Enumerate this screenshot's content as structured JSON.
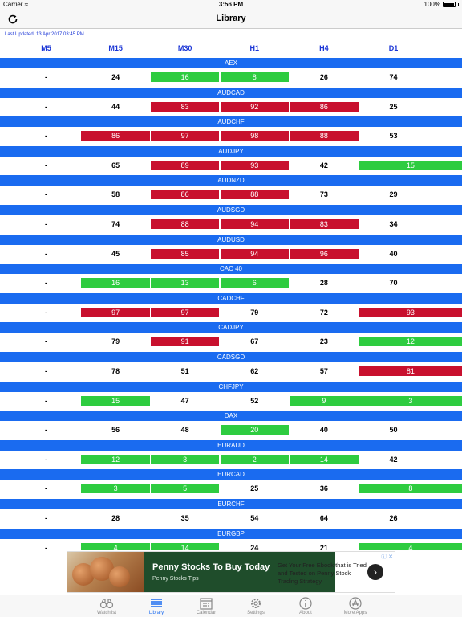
{
  "status": {
    "carrier": "Carrier",
    "time": "3:56 PM",
    "battery": "100%"
  },
  "nav": {
    "title": "Library"
  },
  "last_updated": "Last Updated: 13 Apr 2017 03:45 PM",
  "columns": [
    "M5",
    "M15",
    "M30",
    "H1",
    "H4",
    "D1"
  ],
  "colors": {
    "band": "#1a6bf0",
    "green": "#2ecc40",
    "red": "#c8102e",
    "header": "#1a35d6"
  },
  "rows": [
    {
      "symbol": "AEX",
      "cells": [
        {
          "v": "-",
          "c": ""
        },
        {
          "v": "24",
          "c": ""
        },
        {
          "v": "16",
          "c": "green"
        },
        {
          "v": "8",
          "c": "green"
        },
        {
          "v": "26",
          "c": ""
        },
        {
          "v": "74",
          "c": ""
        }
      ]
    },
    {
      "symbol": "AUDCAD",
      "cells": [
        {
          "v": "-",
          "c": ""
        },
        {
          "v": "44",
          "c": ""
        },
        {
          "v": "83",
          "c": "red"
        },
        {
          "v": "92",
          "c": "red"
        },
        {
          "v": "86",
          "c": "red"
        },
        {
          "v": "25",
          "c": ""
        }
      ]
    },
    {
      "symbol": "AUDCHF",
      "cells": [
        {
          "v": "-",
          "c": ""
        },
        {
          "v": "86",
          "c": "red"
        },
        {
          "v": "97",
          "c": "red"
        },
        {
          "v": "98",
          "c": "red"
        },
        {
          "v": "88",
          "c": "red"
        },
        {
          "v": "53",
          "c": ""
        }
      ]
    },
    {
      "symbol": "AUDJPY",
      "cells": [
        {
          "v": "-",
          "c": ""
        },
        {
          "v": "65",
          "c": ""
        },
        {
          "v": "89",
          "c": "red"
        },
        {
          "v": "93",
          "c": "red"
        },
        {
          "v": "42",
          "c": ""
        },
        {
          "v": "15",
          "c": "green"
        }
      ]
    },
    {
      "symbol": "AUDNZD",
      "cells": [
        {
          "v": "-",
          "c": ""
        },
        {
          "v": "58",
          "c": ""
        },
        {
          "v": "86",
          "c": "red"
        },
        {
          "v": "88",
          "c": "red"
        },
        {
          "v": "73",
          "c": ""
        },
        {
          "v": "29",
          "c": ""
        }
      ]
    },
    {
      "symbol": "AUDSGD",
      "cells": [
        {
          "v": "-",
          "c": ""
        },
        {
          "v": "74",
          "c": ""
        },
        {
          "v": "88",
          "c": "red"
        },
        {
          "v": "94",
          "c": "red"
        },
        {
          "v": "83",
          "c": "red"
        },
        {
          "v": "34",
          "c": ""
        }
      ]
    },
    {
      "symbol": "AUDUSD",
      "cells": [
        {
          "v": "-",
          "c": ""
        },
        {
          "v": "45",
          "c": ""
        },
        {
          "v": "85",
          "c": "red"
        },
        {
          "v": "94",
          "c": "red"
        },
        {
          "v": "96",
          "c": "red"
        },
        {
          "v": "40",
          "c": ""
        }
      ]
    },
    {
      "symbol": "CAC 40",
      "cells": [
        {
          "v": "-",
          "c": ""
        },
        {
          "v": "16",
          "c": "green"
        },
        {
          "v": "13",
          "c": "green"
        },
        {
          "v": "6",
          "c": "green"
        },
        {
          "v": "28",
          "c": ""
        },
        {
          "v": "70",
          "c": ""
        }
      ]
    },
    {
      "symbol": "CADCHF",
      "cells": [
        {
          "v": "-",
          "c": ""
        },
        {
          "v": "97",
          "c": "red"
        },
        {
          "v": "97",
          "c": "red"
        },
        {
          "v": "79",
          "c": ""
        },
        {
          "v": "72",
          "c": ""
        },
        {
          "v": "93",
          "c": "red"
        }
      ]
    },
    {
      "symbol": "CADJPY",
      "cells": [
        {
          "v": "-",
          "c": ""
        },
        {
          "v": "79",
          "c": ""
        },
        {
          "v": "91",
          "c": "red"
        },
        {
          "v": "67",
          "c": ""
        },
        {
          "v": "23",
          "c": ""
        },
        {
          "v": "12",
          "c": "green"
        }
      ]
    },
    {
      "symbol": "CADSGD",
      "cells": [
        {
          "v": "-",
          "c": ""
        },
        {
          "v": "78",
          "c": ""
        },
        {
          "v": "51",
          "c": ""
        },
        {
          "v": "62",
          "c": ""
        },
        {
          "v": "57",
          "c": ""
        },
        {
          "v": "81",
          "c": "red"
        }
      ]
    },
    {
      "symbol": "CHFJPY",
      "cells": [
        {
          "v": "-",
          "c": ""
        },
        {
          "v": "15",
          "c": "green"
        },
        {
          "v": "47",
          "c": ""
        },
        {
          "v": "52",
          "c": ""
        },
        {
          "v": "9",
          "c": "green"
        },
        {
          "v": "3",
          "c": "green"
        }
      ]
    },
    {
      "symbol": "DAX",
      "cells": [
        {
          "v": "-",
          "c": ""
        },
        {
          "v": "56",
          "c": ""
        },
        {
          "v": "48",
          "c": ""
        },
        {
          "v": "20",
          "c": "green"
        },
        {
          "v": "40",
          "c": ""
        },
        {
          "v": "50",
          "c": ""
        }
      ]
    },
    {
      "symbol": "EURAUD",
      "cells": [
        {
          "v": "-",
          "c": ""
        },
        {
          "v": "12",
          "c": "green"
        },
        {
          "v": "3",
          "c": "green"
        },
        {
          "v": "2",
          "c": "green"
        },
        {
          "v": "14",
          "c": "green"
        },
        {
          "v": "42",
          "c": ""
        }
      ]
    },
    {
      "symbol": "EURCAD",
      "cells": [
        {
          "v": "-",
          "c": ""
        },
        {
          "v": "3",
          "c": "green"
        },
        {
          "v": "5",
          "c": "green"
        },
        {
          "v": "25",
          "c": ""
        },
        {
          "v": "36",
          "c": ""
        },
        {
          "v": "8",
          "c": "green"
        }
      ]
    },
    {
      "symbol": "EURCHF",
      "cells": [
        {
          "v": "-",
          "c": ""
        },
        {
          "v": "28",
          "c": ""
        },
        {
          "v": "35",
          "c": ""
        },
        {
          "v": "54",
          "c": ""
        },
        {
          "v": "64",
          "c": ""
        },
        {
          "v": "26",
          "c": ""
        }
      ]
    },
    {
      "symbol": "EURGBP",
      "cells": [
        {
          "v": "-",
          "c": ""
        },
        {
          "v": "4",
          "c": "green"
        },
        {
          "v": "14",
          "c": "green"
        },
        {
          "v": "24",
          "c": ""
        },
        {
          "v": "21",
          "c": ""
        },
        {
          "v": "4",
          "c": "green"
        }
      ]
    }
  ],
  "ad": {
    "title": "Penny Stocks To Buy Today",
    "subtitle": "Penny Stocks Tips",
    "body": "Get Your Free Ebook that is Tried and Tested on Penny Stock Trading Strategy.",
    "arrow": "›",
    "close": "ⓘ ✕"
  },
  "tabs": [
    {
      "label": "Watchlist",
      "icon": "binoculars-icon",
      "active": false
    },
    {
      "label": "Library",
      "icon": "list-icon",
      "active": true
    },
    {
      "label": "Calendar",
      "icon": "calendar-icon",
      "active": false
    },
    {
      "label": "Settings",
      "icon": "gear-icon",
      "active": false
    },
    {
      "label": "About",
      "icon": "info-icon",
      "active": false
    },
    {
      "label": "More Apps",
      "icon": "appstore-icon",
      "active": false
    }
  ]
}
